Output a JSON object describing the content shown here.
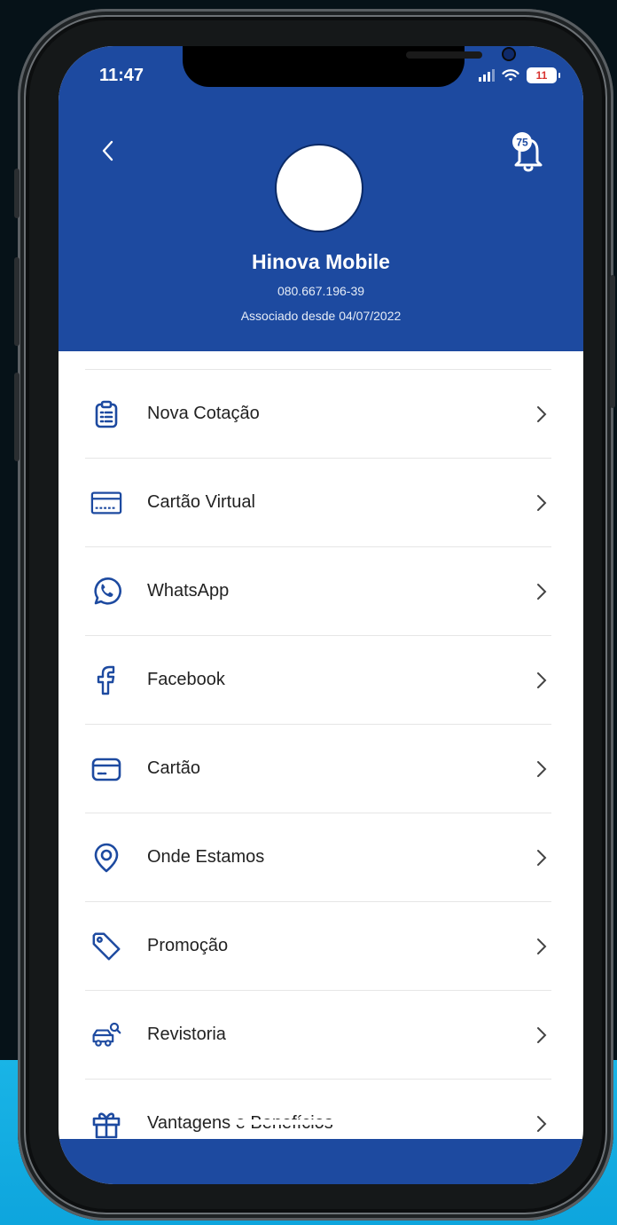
{
  "status_bar": {
    "time": "11:47",
    "battery": "11"
  },
  "header": {
    "notification_count": "75",
    "user_name": "Hinova Mobile",
    "cpf": "080.667.196-39",
    "member_since": "Associado desde 04/07/2022",
    "color": "#1d4aa0"
  },
  "menu": [
    {
      "label": "Nova Cotação",
      "icon": "clipboard-icon"
    },
    {
      "label": "Cartão Virtual",
      "icon": "virtual-card-icon"
    },
    {
      "label": "WhatsApp",
      "icon": "whatsapp-icon"
    },
    {
      "label": "Facebook",
      "icon": "facebook-icon"
    },
    {
      "label": "Cartão",
      "icon": "credit-card-icon"
    },
    {
      "label": "Onde Estamos",
      "icon": "location-pin-icon"
    },
    {
      "label": "Promoção",
      "icon": "tag-icon"
    },
    {
      "label": "Revistoria",
      "icon": "car-inspection-icon"
    },
    {
      "label": "Vantagens e Benefícios",
      "icon": "gift-icon"
    }
  ],
  "accent_color": "#1d4aa0"
}
